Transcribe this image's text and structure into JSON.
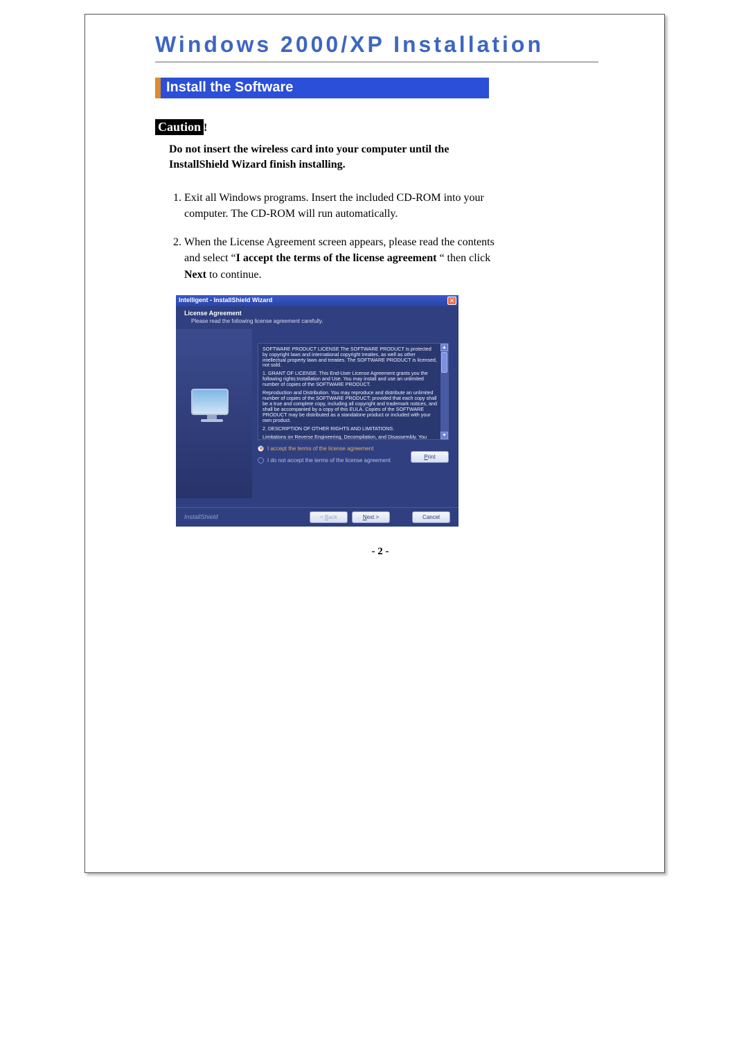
{
  "page": {
    "title": "Windows 2000/XP Installation",
    "section_heading": "Install the Software",
    "caution_label": "Caution",
    "caution_bang": "!",
    "caution_text": "Do not insert the wireless card into your computer until the InstallShield Wizard finish installing.",
    "steps": [
      "Exit all Windows programs. Insert the included CD-ROM into your computer. The CD-ROM will run automatically.",
      "When the License Agreement screen appears, please read the contents and select “I accept the terms of the license agreement “ then click Next to continue."
    ],
    "step2_bold": "I accept the terms of the license agreement",
    "step2_bold2": "Next",
    "page_number": "- 2 -"
  },
  "installer": {
    "window_title": "Intelligent - InstallShield Wizard",
    "close_glyph": "✕",
    "header_title": "License Agreement",
    "header_sub": "Please read the following license agreement carefully.",
    "license_paragraphs": [
      "SOFTWARE PRODUCT LICENSE\nThe SOFTWARE PRODUCT is protected by copyright laws and international copyright treaties, as well as other intellectual property laws and treaties. The SOFTWARE PRODUCT is licensed, not sold.",
      "1. GRANT OF LICENSE. This End-User License Agreement grants you the following rights:Installation and Use. You may install and use an unlimited number of copies of the SOFTWARE PRODUCT.",
      "Reproduction and Distribution. You may reproduce and distribute an unlimited number of copies of the SOFTWARE PRODUCT; provided that each copy shall be a true and complete copy, including all copyright and trademark notices, and shall be accompanied by a copy of this EULA. Copies of the SOFTWARE PRODUCT may be distributed as a standalone product or included with your own product.",
      "2. DESCRIPTION OF OTHER RIGHTS AND LIMITATIONS.",
      "Limitations on Reverse Engineering, Decompilation, and Disassembly. You may not reverse"
    ],
    "radio_accept": "I accept the terms of the license agreement",
    "radio_decline": "I do not accept the terms of the license agreement",
    "print_label": "Print",
    "brand": "InstallShield",
    "btn_back": "< Back",
    "btn_next": "Next >",
    "btn_cancel": "Cancel",
    "scroll_up": "▲",
    "scroll_down": "▼"
  }
}
